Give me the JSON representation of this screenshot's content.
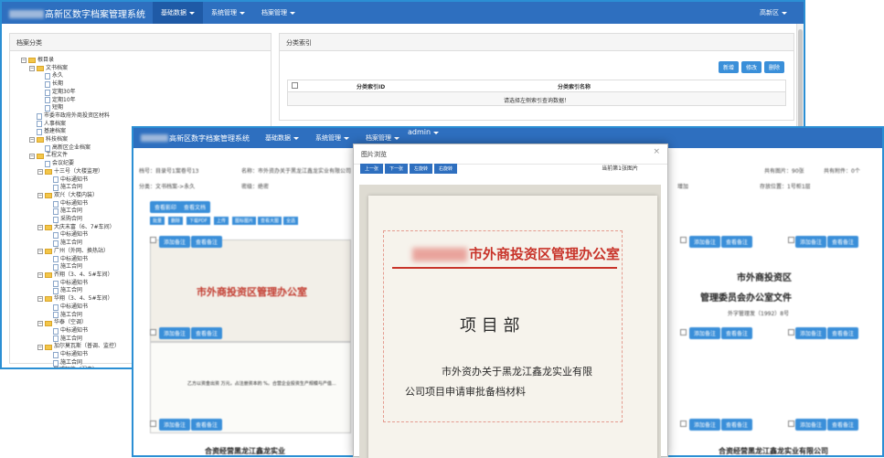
{
  "app": {
    "title": "高新区数字档案管理系统",
    "menu": [
      {
        "label": "基础数据",
        "active": true
      },
      {
        "label": "系统管理",
        "active": false
      },
      {
        "label": "档案管理",
        "active": false
      }
    ],
    "user": "高新区"
  },
  "left_panel": {
    "title": "档案分类",
    "tree": [
      {
        "d": 0,
        "t": "tg",
        "label": "根目录"
      },
      {
        "d": 1,
        "t": "tg",
        "label": "文书档案"
      },
      {
        "d": 2,
        "t": "fi",
        "label": "永久"
      },
      {
        "d": 2,
        "t": "fi",
        "label": "长期"
      },
      {
        "d": 2,
        "t": "fi",
        "label": "定期30年"
      },
      {
        "d": 2,
        "t": "fi",
        "label": "定期10年"
      },
      {
        "d": 2,
        "t": "fi",
        "label": "短期"
      },
      {
        "d": 1,
        "t": "fi",
        "label": "市委市政府外商投资区材料"
      },
      {
        "d": 1,
        "t": "fi",
        "label": "人事档案"
      },
      {
        "d": 1,
        "t": "fi",
        "label": "基建档案"
      },
      {
        "d": 1,
        "t": "tg",
        "label": "科技档案"
      },
      {
        "d": 2,
        "t": "fi",
        "label": "高新区企业档案"
      },
      {
        "d": 1,
        "t": "tg",
        "label": "工程文件"
      },
      {
        "d": 2,
        "t": "fi",
        "label": "会议纪要"
      },
      {
        "d": 2,
        "t": "tg",
        "label": "十三号（大楼监理）"
      },
      {
        "d": 3,
        "t": "fi",
        "label": "中标通知书"
      },
      {
        "d": 3,
        "t": "fi",
        "label": "施工合同"
      },
      {
        "d": 2,
        "t": "tg",
        "label": "双兴（大楼内装）"
      },
      {
        "d": 3,
        "t": "fi",
        "label": "中标通知书"
      },
      {
        "d": 3,
        "t": "fi",
        "label": "施工合同"
      },
      {
        "d": 3,
        "t": "fi",
        "label": "采购合同"
      },
      {
        "d": 2,
        "t": "tg",
        "label": "大庆末富（6、7#车间）"
      },
      {
        "d": 3,
        "t": "fi",
        "label": "中标通知书"
      },
      {
        "d": 3,
        "t": "fi",
        "label": "施工合同"
      },
      {
        "d": 2,
        "t": "tg",
        "label": "广州（外网、换热站）"
      },
      {
        "d": 3,
        "t": "fi",
        "label": "中标通知书"
      },
      {
        "d": 3,
        "t": "fi",
        "label": "施工合同"
      },
      {
        "d": 2,
        "t": "tg",
        "label": "齐翔（3、4、5#车间）"
      },
      {
        "d": 3,
        "t": "fi",
        "label": "中标通知书"
      },
      {
        "d": 3,
        "t": "fi",
        "label": "施工合同"
      },
      {
        "d": 2,
        "t": "tg",
        "label": "华翔（3、4、5#车间）"
      },
      {
        "d": 3,
        "t": "fi",
        "label": "中标通知书"
      },
      {
        "d": 3,
        "t": "fi",
        "label": "施工合同"
      },
      {
        "d": 2,
        "t": "tg",
        "label": "华泰（空调）"
      },
      {
        "d": 3,
        "t": "fi",
        "label": "中标通知书"
      },
      {
        "d": 3,
        "t": "fi",
        "label": "施工合同"
      },
      {
        "d": 2,
        "t": "tg",
        "label": "加尔莫瓦斯（普调、监控）"
      },
      {
        "d": 3,
        "t": "fi",
        "label": "中标通知书"
      },
      {
        "d": 3,
        "t": "fi",
        "label": "施工合同"
      },
      {
        "d": 2,
        "t": "tg",
        "label": "联盟智能（弱电）"
      },
      {
        "d": 3,
        "t": "fi",
        "label": "中标通知书"
      },
      {
        "d": 3,
        "t": "fi",
        "label": "施工合同"
      }
    ]
  },
  "right_panel": {
    "title": "分类索引",
    "buttons": [
      "新增",
      "修改",
      "删除"
    ],
    "columns": [
      "分类索引ID",
      "分类索引名称"
    ],
    "empty": "请选择左侧索引查询数据！"
  },
  "win2": {
    "title": "高新区数字档案管理系统",
    "menu": [
      "基础数据",
      "系统管理",
      "档案管理"
    ],
    "user": "admin",
    "info": {
      "num": "档号：目录号1案卷号13",
      "name": "名称：市外资办关于黑龙江鑫龙实业有限公司",
      "cat": "分类：文书档案->永久",
      "sec": "密级：绝密",
      "total": "共有图片：90张",
      "att": "共有附件：0个",
      "add": "增加",
      "loc": "存放位置：1号柜1层"
    },
    "btn_row1": [
      "查看影印",
      "查看文档"
    ],
    "btn_row2": [
      "批量",
      "删除",
      "下载PDF",
      "上传",
      "图标图片",
      "查看大图",
      "全选"
    ],
    "card_btns": [
      "添加备注",
      "查看备注"
    ],
    "doc_left": "合资经营黑龙江鑫龙实业",
    "doc_right": "合资经营黑龙江鑫龙实业有限公司",
    "doc_title1": "市外商投资区",
    "doc_title2": "管理委员会办公室文件",
    "doc_num": "外字管理发（1992）8号"
  },
  "modal": {
    "title": "图片浏览",
    "close": "×",
    "buttons": [
      "上一张",
      "下一张",
      "左旋转",
      "右旋转"
    ],
    "current": "当前第1张图片",
    "photo": {
      "header": "市外商投资区管理办公室",
      "line1": "项 目 部",
      "line2": "市外资办关于黑龙江鑫龙实业有限",
      "line3": "公司项目申请审批备档材料"
    }
  }
}
